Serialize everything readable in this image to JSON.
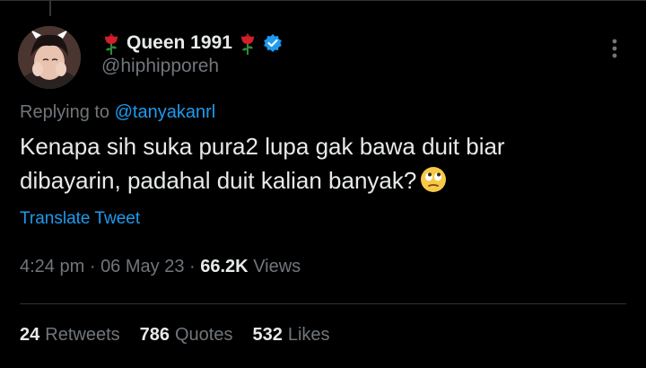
{
  "tweet": {
    "author": {
      "display_name": "Queen 1991",
      "handle": "@hiphipporeh",
      "verified": true,
      "name_decoration_icon": "rose-icon"
    },
    "replying_to_label": "Replying to",
    "replying_to_handle": "@tanyakanrl",
    "text": "Kenapa sih suka pura2 lupa gak bawa duit biar dibayarin, padahal duit kalian banyak?",
    "text_emoji": "eye-roll-emoji",
    "translate_label": "Translate Tweet",
    "time": "4:24 pm",
    "date": "06 May 23",
    "views_count": "66.2K",
    "views_label": "Views",
    "separator": "·"
  },
  "stats": [
    {
      "count": "24",
      "label": "Retweets"
    },
    {
      "count": "786",
      "label": "Quotes"
    },
    {
      "count": "532",
      "label": "Likes"
    }
  ],
  "colors": {
    "background": "#000000",
    "text_primary": "#e7e9ea",
    "text_secondary": "#71767b",
    "accent": "#1d9bf0",
    "rose": "#d0202a",
    "divider": "#2f3336"
  }
}
